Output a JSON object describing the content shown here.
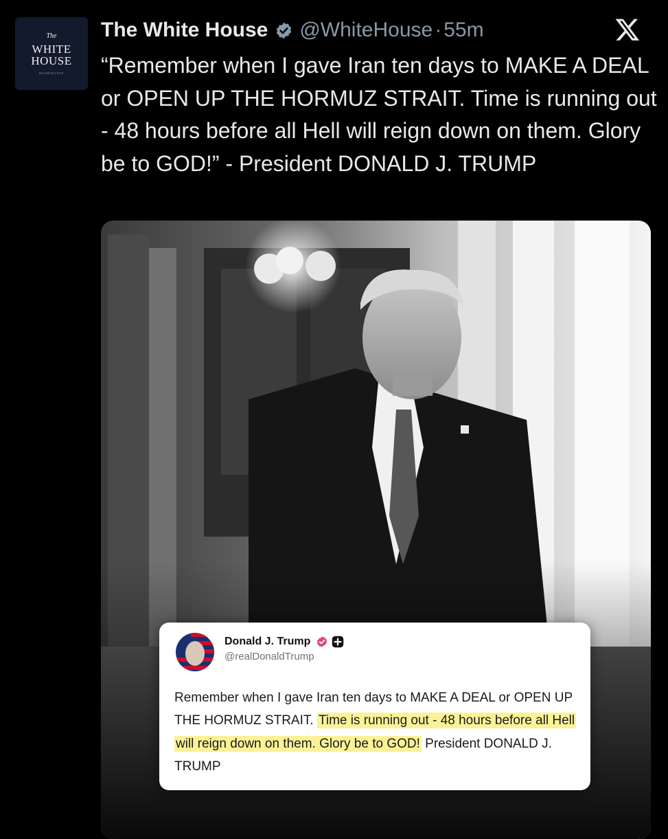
{
  "account": {
    "avatar_top": "The",
    "avatar_line1": "WHITE",
    "avatar_line2": "HOUSE",
    "avatar_bottom": "WASHINGTON",
    "name": "The White House",
    "handle": "@WhiteHouse",
    "separator": "·",
    "time": "55m"
  },
  "tweet": {
    "text": "“Remember when I gave Iran ten days to MAKE A DEAL or OPEN UP THE HORMUZ STRAIT. Time is running out - 48 hours before all Hell will reign down on them. Glory be to GOD!” - President DONALD J. TRUMP"
  },
  "embedded_post": {
    "name": "Donald J. Trump",
    "handle": "@realDonaldTrump",
    "text_plain": "Remember when I gave Iran ten days to MAKE A DEAL or OPEN UP THE HORMUZ STRAIT. ",
    "text_highlight": "Time is running out - 48 hours before all Hell will reign down on them. Glory be to GOD!",
    "text_tail": " President DONALD J. TRUMP"
  },
  "icons": {
    "verified": "verified-checkmark-icon",
    "platform": "x-logo-icon",
    "card_badge": "verified-badge-icon",
    "card_plus": "plus-badge-icon"
  },
  "colors": {
    "background": "#000000",
    "text": "#e7e9ea",
    "secondary_text": "#8b98a5",
    "verified_badge": "#829aab",
    "card_badge": "#e0447a",
    "highlight": "#fbf297"
  }
}
